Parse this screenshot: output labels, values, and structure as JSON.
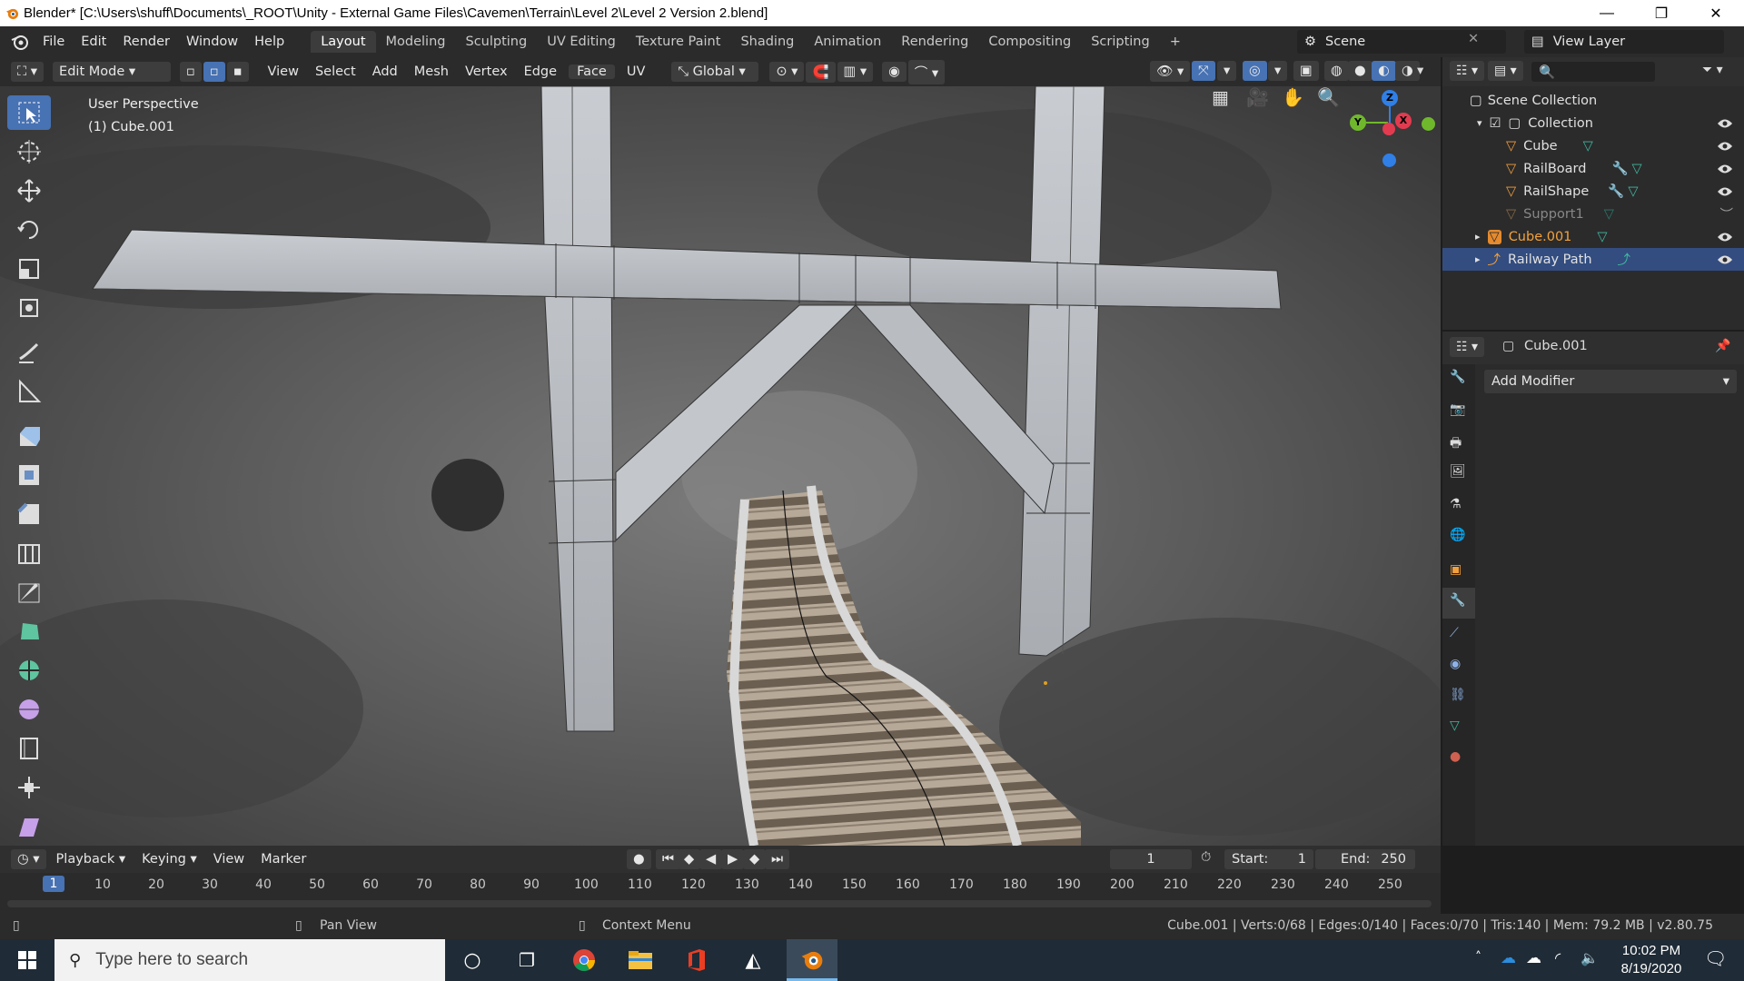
{
  "window": {
    "title": "Blender* [C:\\Users\\shuff\\Documents\\_ROOT\\Unity - External Game Files\\Cavemen\\Terrain\\Level 2\\Level 2 Version 2.blend]",
    "minimize": "—",
    "maximize": "❐",
    "close": "✕"
  },
  "menubar": {
    "menus": [
      "File",
      "Edit",
      "Render",
      "Window",
      "Help"
    ],
    "workspaces": [
      "Layout",
      "Modeling",
      "Sculpting",
      "UV Editing",
      "Texture Paint",
      "Shading",
      "Animation",
      "Rendering",
      "Compositing",
      "Scripting"
    ],
    "active_workspace": "Layout",
    "add_tab": "+",
    "scene_name": "Scene",
    "view_layer": "View Layer"
  },
  "viewport_header": {
    "mode": "Edit Mode",
    "menus": [
      "View",
      "Select",
      "Add",
      "Mesh",
      "Vertex",
      "Edge",
      "Face",
      "UV"
    ],
    "transform_orientation": "Global"
  },
  "viewport": {
    "perspective_label": "User Perspective",
    "object_label": "(1) Cube.001",
    "gizmo": {
      "z": "Z",
      "y": "Y",
      "x": "X"
    }
  },
  "outliner": {
    "root": "Scene Collection",
    "collection": "Collection",
    "items": [
      {
        "name": "Cube",
        "modifier": false,
        "hidden": false
      },
      {
        "name": "RailBoard",
        "modifier": true,
        "hidden": false
      },
      {
        "name": "RailShape",
        "modifier": true,
        "hidden": false
      },
      {
        "name": "Support1",
        "modifier": false,
        "hidden": true
      }
    ],
    "cube001": "Cube.001",
    "railway": "Railway Path"
  },
  "properties": {
    "object_name": "Cube.001",
    "add_modifier": "Add Modifier"
  },
  "timeline": {
    "menus": [
      "Playback",
      "Keying",
      "View",
      "Marker"
    ],
    "current_frame": "1",
    "start_label": "Start:",
    "start": "1",
    "end_label": "End:",
    "end": "250",
    "ruler": [
      "1",
      "10",
      "20",
      "30",
      "40",
      "50",
      "60",
      "70",
      "80",
      "90",
      "100",
      "110",
      "120",
      "130",
      "140",
      "150",
      "160",
      "170",
      "180",
      "190",
      "200",
      "210",
      "220",
      "230",
      "240",
      "250"
    ]
  },
  "statusbar": {
    "pan": "Pan View",
    "context": "Context Menu",
    "stats": "Cube.001 | Verts:0/68 | Edges:0/140 | Faces:0/70 | Tris:140 | Mem: 79.2 MB | v2.80.75"
  },
  "taskbar": {
    "search_placeholder": "Type here to search",
    "time": "10:02 PM",
    "date": "8/19/2020"
  },
  "colors": {
    "accent": "#4772b3",
    "selected_row": "#334d80",
    "active_object": "#f2a23c",
    "blender_orange": "#e87d0d"
  }
}
